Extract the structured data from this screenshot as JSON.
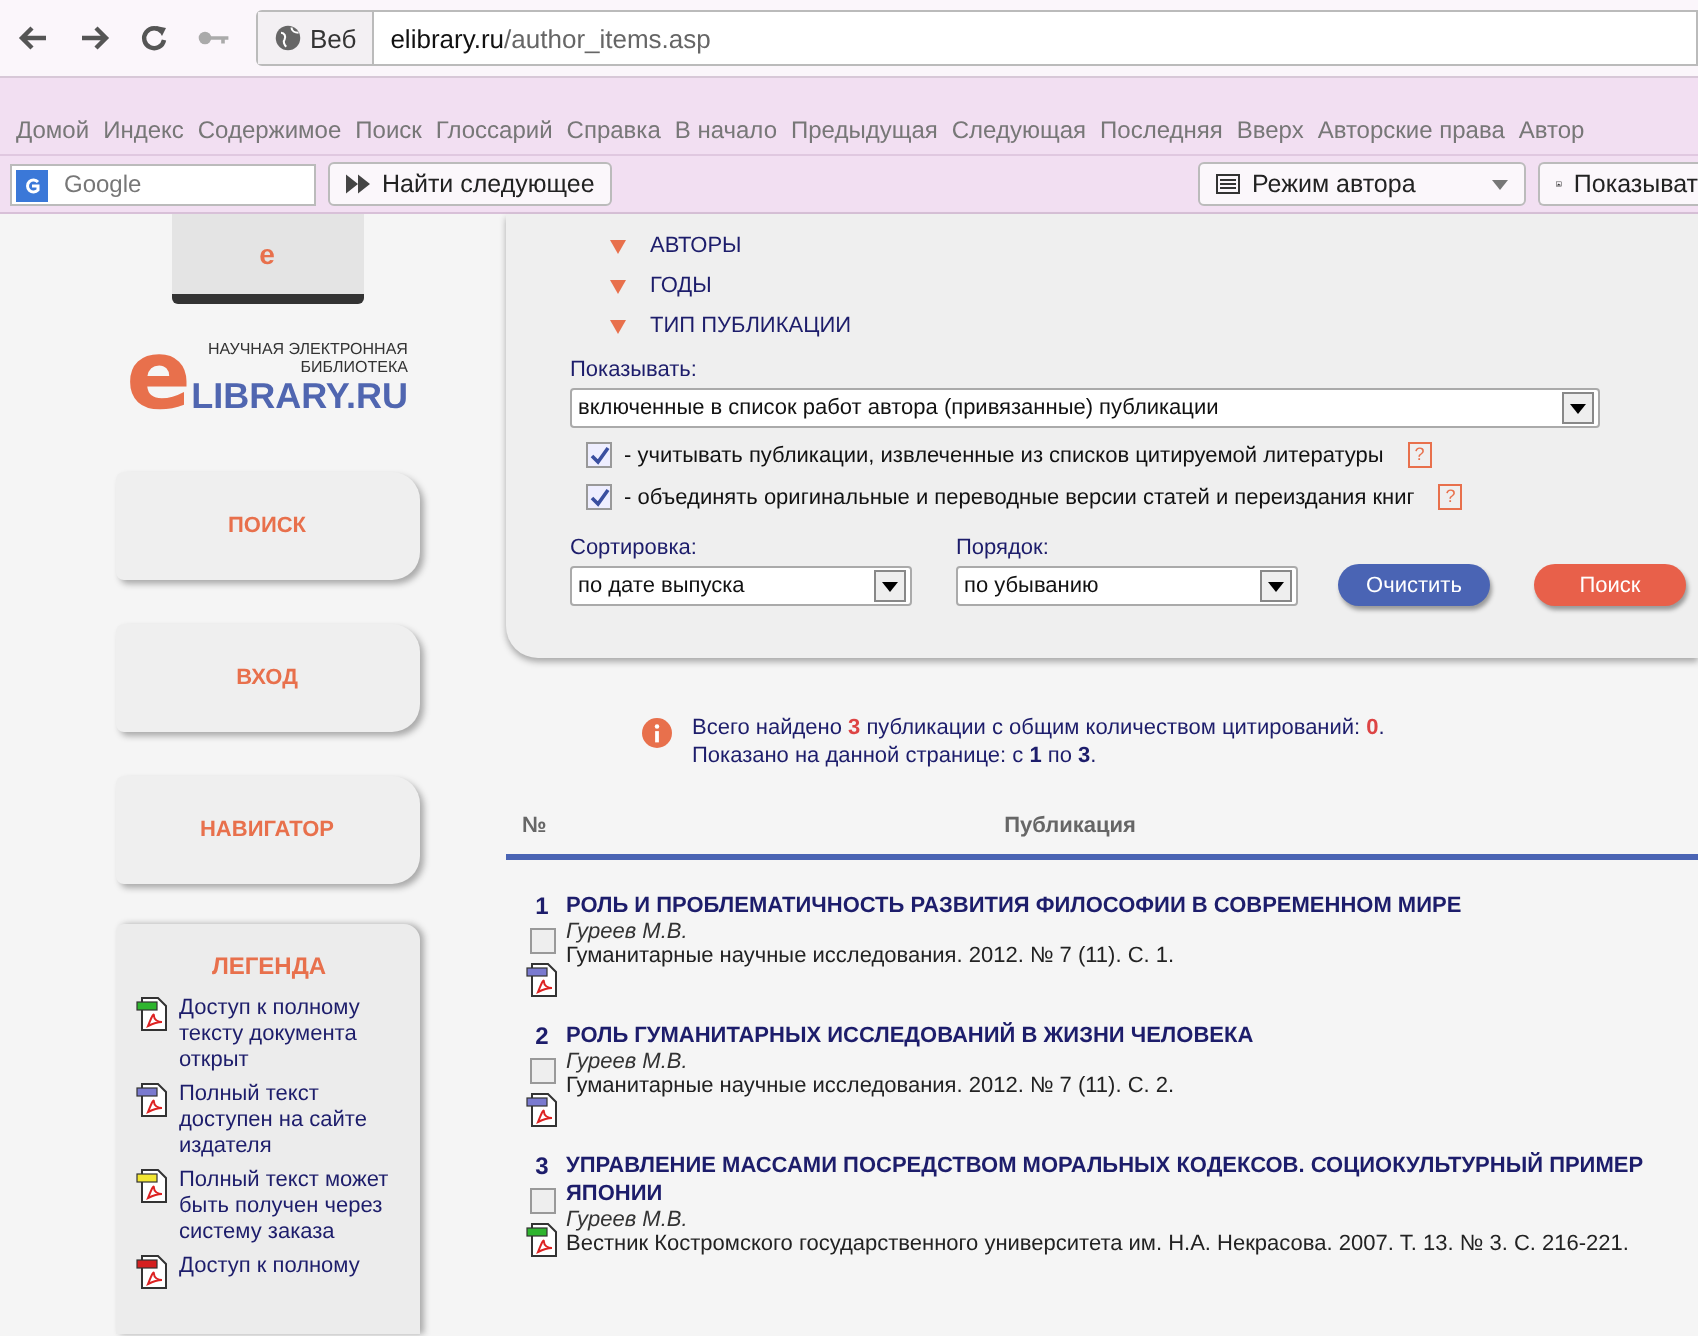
{
  "browser": {
    "site_label": "Веб",
    "url_host": "elibrary.ru",
    "url_path": "/author_items.asp"
  },
  "menu": [
    "Домой",
    "Индекс",
    "Содержимое",
    "Поиск",
    "Глоссарий",
    "Справка",
    "В начало",
    "Предыдущая",
    "Следующая",
    "Последняя",
    "Вверх",
    "Авторские права",
    "Автор"
  ],
  "toolbar": {
    "search_placeholder": "Google",
    "find_next": "Найти следующее",
    "mode": "Режим автора",
    "show": "Показыват"
  },
  "laptop_letter": "e",
  "logo": {
    "tagline_1": "НАУЧНАЯ ЭЛЕКТРОННАЯ",
    "tagline_2": "БИБЛИОТЕКА",
    "letter": "e",
    "name": "LIBRARY.RU"
  },
  "sidebar": {
    "buttons": [
      "ПОИСК",
      "ВХОД",
      "НАВИГАТОР"
    ],
    "legend_title": "ЛЕГЕНДА",
    "legend": [
      {
        "text": "Доступ к полному тексту документа открыт",
        "color": "#2fb52f"
      },
      {
        "text": "Полный текст доступен на сайте издателя",
        "color": "#7a7ad0"
      },
      {
        "text": "Полный текст может быть получен через систему заказа",
        "color": "#f2e632"
      },
      {
        "text": "Доступ к полному",
        "color": "#d42020"
      }
    ]
  },
  "filters": {
    "facets": [
      {
        "label": "АВТОРЫ",
        "expanded": false
      },
      {
        "label": "ГОДЫ",
        "expanded": false
      },
      {
        "label": "ТИП ПУБЛИКАЦИИ",
        "expanded": false
      }
    ],
    "show_label": "Показывать:",
    "show_value": "включенные в список работ автора (привязанные) публикации",
    "options": [
      {
        "label": "- учитывать публикации, извлеченные из списков цитируемой литературы",
        "checked": true,
        "help": "?"
      },
      {
        "label": "- объединять оригинальные и переводные версии статей и переиздания книг",
        "checked": true,
        "help": "?"
      }
    ],
    "sort_label": "Сортировка:",
    "sort_value": "по дате выпуска",
    "order_label": "Порядок:",
    "order_value": "по убыванию",
    "clear_button": "Очистить",
    "search_button": "Поиск"
  },
  "summary": {
    "line_1": "Всего найдено **3** публикации с общим количеством цитирований: **0**.",
    "line_2": "Показано на данной странице: с **1** по **3**."
  },
  "table": {
    "columns": [
      "№",
      "Публикация"
    ],
    "rows": [
      {
        "number": "1",
        "title": "РОЛЬ И ПРОБЛЕМАТИЧНОСТЬ РАЗВИТИЯ ФИЛОСОФИИ В СОВРЕМЕННОМ МИРЕ",
        "author": "Гуреев М.В.",
        "source": "Гуманитарные научные исследования. 2012. № 7 (11). С. 1.",
        "checked": false,
        "color": "#7a7ad0"
      },
      {
        "number": "2",
        "title": "РОЛЬ ГУМАНИТАРНЫХ ИССЛЕДОВАНИЙ В ЖИЗНИ ЧЕЛОВЕКА",
        "author": "Гуреев М.В.",
        "source": "Гуманитарные научные исследования. 2012. № 7 (11). С. 2.",
        "checked": false,
        "color": "#7a7ad0"
      },
      {
        "number": "3",
        "title": "УПРАВЛЕНИЕ МАССАМИ ПОСРЕДСТВОМ МОРАЛЬНЫХ КОДЕКСОВ. СОЦИОКУЛЬТУРНЫЙ ПРИМЕР ЯПОНИИ",
        "author": "Гуреев М.В.",
        "source": "Вестник Костромского государственного университета им. Н.А. Некрасова. 2007. Т. 13. № 3. С. 216-221.",
        "checked": false,
        "color": "#2fb52f"
      }
    ]
  }
}
